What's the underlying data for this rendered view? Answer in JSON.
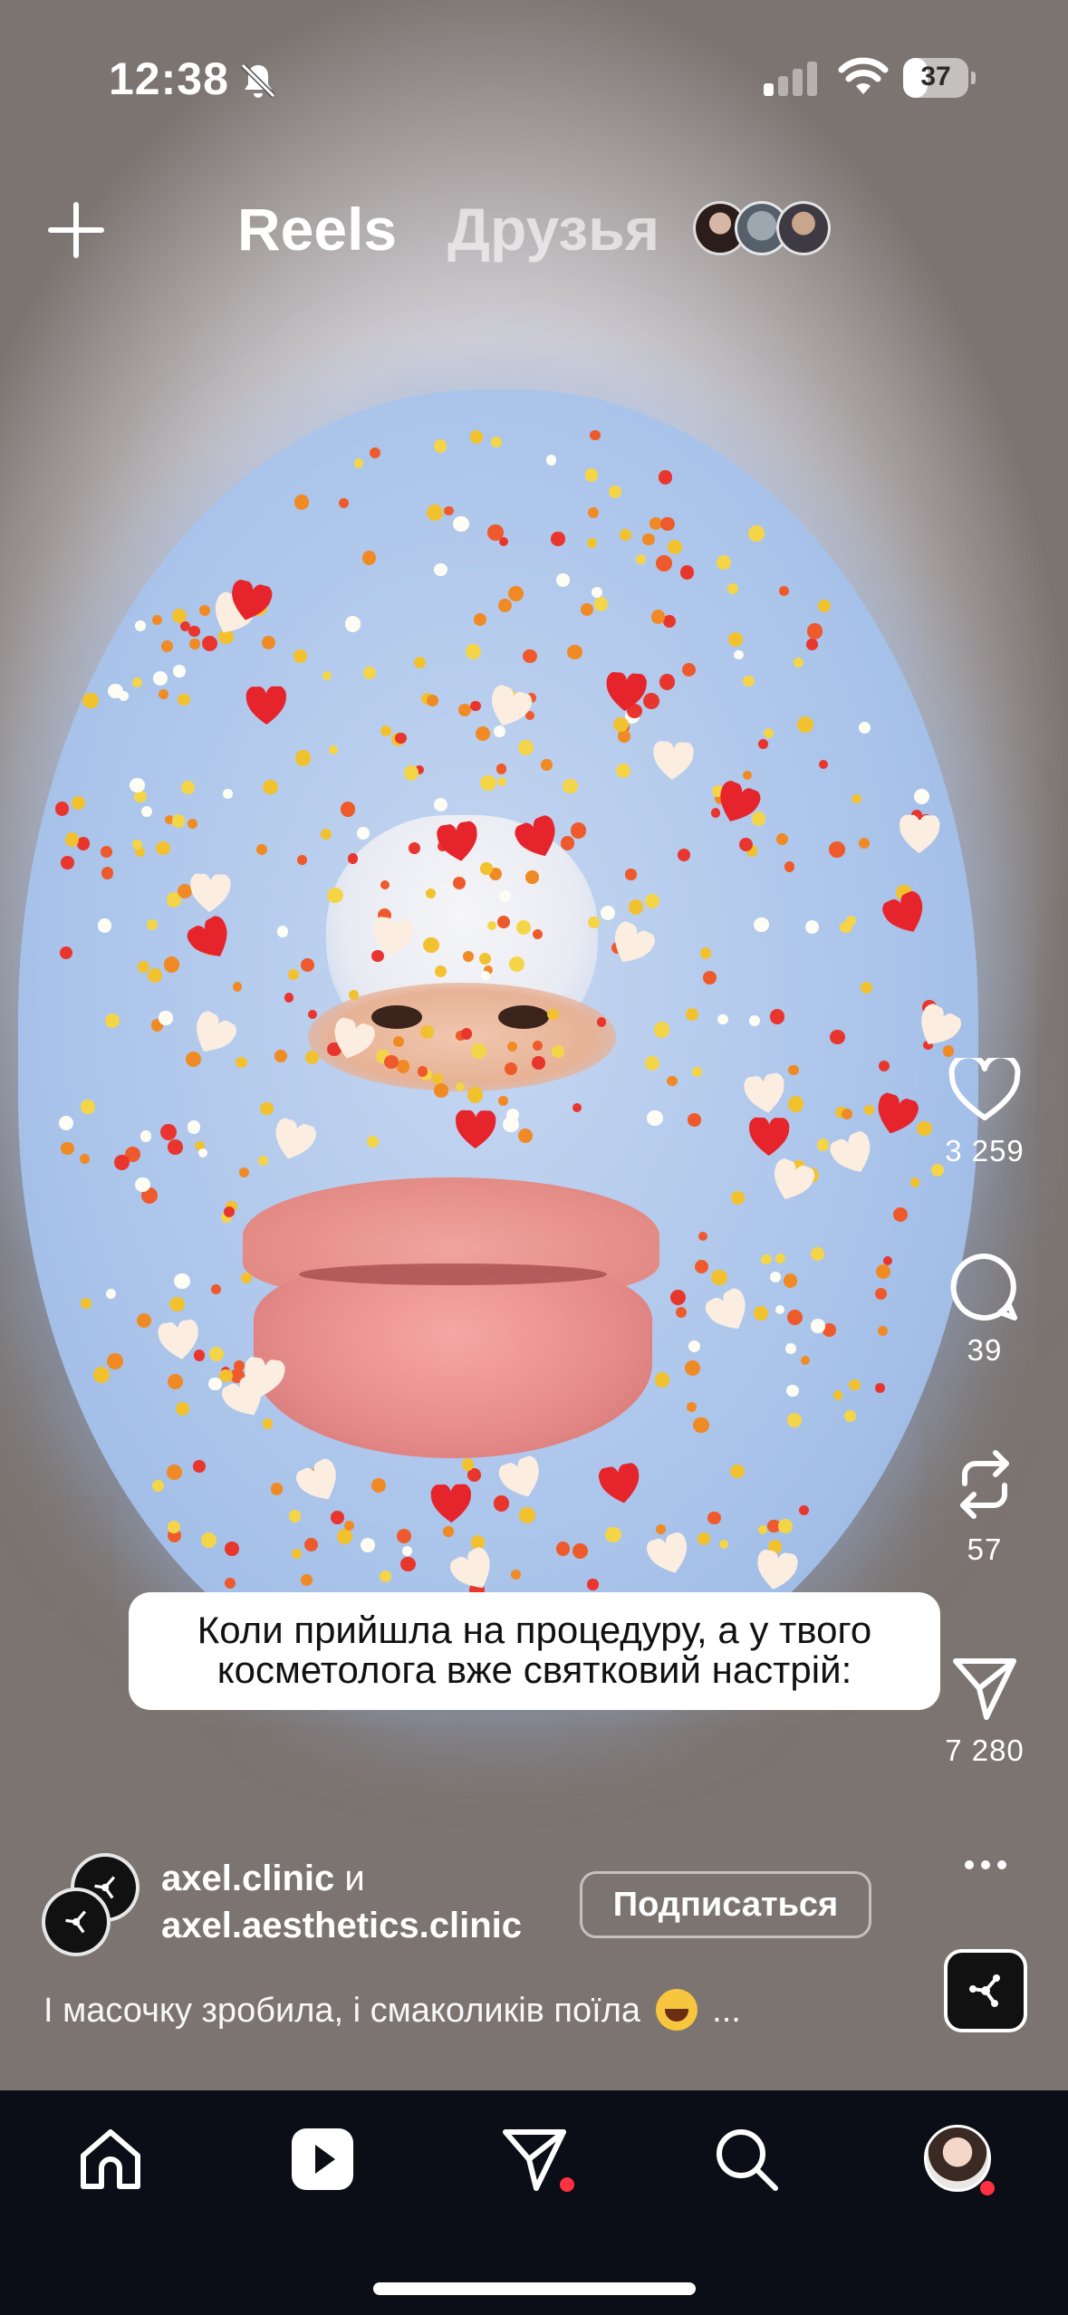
{
  "status_bar": {
    "time": "12:38",
    "battery": 37,
    "icons": [
      "bell-off-icon",
      "signal-icon",
      "wifi-icon",
      "battery-icon"
    ]
  },
  "top_nav": {
    "create_icon": "plus-icon",
    "tabs": [
      {
        "label": "Reels",
        "active": true
      },
      {
        "label": "Друзья",
        "active": false
      }
    ],
    "friend_avatars": 3
  },
  "caption_sticker": {
    "line1": "Коли прийшла на процедуру, а у твого",
    "line2": "косметолога вже святковий настрій:"
  },
  "actions": {
    "likes": "3 259",
    "comments": "39",
    "reposts": "57",
    "shares": "7 280"
  },
  "author": {
    "name1": "axel.clinic",
    "joiner": " и",
    "name2": "axel.aesthetics.clinic",
    "follow_label": "Подписаться"
  },
  "description": {
    "text": "І масочку зробила, і смаколиків поїла",
    "emoji": "😂",
    "more": "..."
  },
  "tab_bar": {
    "items": [
      "home-icon",
      "reels-icon",
      "messages-icon",
      "search-icon",
      "profile-avatar"
    ]
  },
  "colors": {
    "background": "#0b0e16",
    "notification_dot": "#ff3040",
    "sticker_bg": "#ffffff"
  }
}
